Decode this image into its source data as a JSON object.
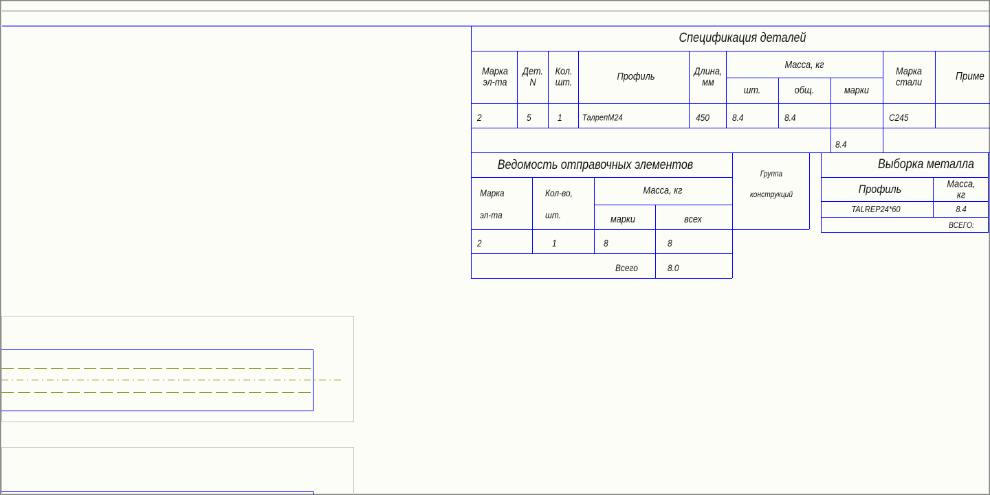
{
  "colors": {
    "table_lines": "#0000ff",
    "frame": "#808080",
    "viewport": "#c0c0c0",
    "axis_lines": "#808000",
    "background": "#fdfdf8"
  },
  "spec": {
    "title": "Спецификация деталей",
    "headers": {
      "mark": "Марка\nэл-та",
      "det": "Дет.\nN",
      "qty": "Кол.\nшт.",
      "profile": "Профиль",
      "length": "Длина,\nмм",
      "mass": "Масса, кг",
      "mass_piece": "шт.",
      "mass_total": "общ.",
      "mass_mark": "марки",
      "steel": "Марка\nстали",
      "note": "Приме"
    },
    "rows": [
      {
        "mark": "2",
        "det": "5",
        "qty": "1",
        "profile": "ТалрепМ24",
        "length": "450",
        "mass_piece": "8.4",
        "mass_total": "8.4",
        "mass_mark": "",
        "steel": "С245",
        "note": ""
      }
    ],
    "total_mark_mass": "8.4"
  },
  "vedomost": {
    "title": "Ведомость отправочных элементов",
    "headers": {
      "mark": "Марка\nэл-та",
      "qty": "Кол-во,\nшт.",
      "mass": "Масса, кг",
      "mass_mark": "марки",
      "mass_all": "всех"
    },
    "rows": [
      {
        "mark": "2",
        "qty": "1",
        "mass_mark": "8",
        "mass_all": "8"
      }
    ],
    "total_label": "Всего",
    "total_value": "8.0"
  },
  "group": {
    "label": "Группа\nконструкций"
  },
  "vyborka": {
    "title": "Выборка металла",
    "headers": {
      "profile": "Профиль",
      "mass": "Масса,\nкг"
    },
    "rows": [
      {
        "profile": "TALREP24*60",
        "mass": "8.4"
      }
    ],
    "total_label": "ВСЕГО:"
  }
}
